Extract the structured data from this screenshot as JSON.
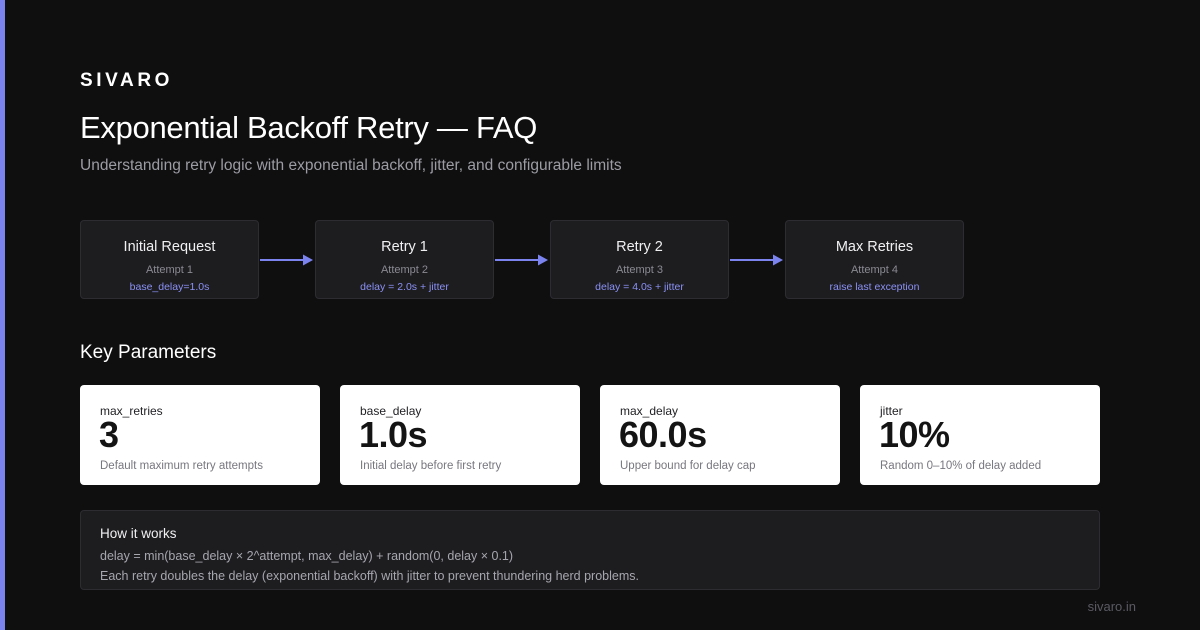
{
  "brand": "SIVARO",
  "title": "Exponential Backoff Retry — FAQ",
  "subtitle": "Understanding retry logic with exponential backoff, jitter, and configurable limits",
  "flow": {
    "steps": [
      {
        "title": "Initial Request",
        "attempt": "Attempt 1",
        "note": "base_delay=1.0s"
      },
      {
        "title": "Retry 1",
        "attempt": "Attempt 2",
        "note": "delay = 2.0s + jitter"
      },
      {
        "title": "Retry 2",
        "attempt": "Attempt 3",
        "note": "delay = 4.0s + jitter"
      },
      {
        "title": "Max Retries",
        "attempt": "Attempt 4",
        "note": "raise last exception"
      }
    ]
  },
  "params_title": "Key Parameters",
  "params": [
    {
      "label": "max_retries",
      "value": "3",
      "desc": "Default maximum retry attempts"
    },
    {
      "label": "base_delay",
      "value": "1.0s",
      "desc": "Initial delay before first retry"
    },
    {
      "label": "max_delay",
      "value": "60.0s",
      "desc": "Upper bound for delay cap"
    },
    {
      "label": "jitter",
      "value": "10%",
      "desc": "Random 0–10% of delay added"
    }
  ],
  "how": {
    "title": "How it works",
    "formula": "delay = min(base_delay × 2^attempt, max_delay) + random(0, delay × 0.1)",
    "desc": "Each retry doubles the delay (exponential backoff) with jitter to prevent thundering herd problems."
  },
  "footer": "sivaro.in",
  "colors": {
    "background": "#0f0f10",
    "accent": "#7b83ee",
    "box": "#1d1d20",
    "card": "#ffffff"
  }
}
